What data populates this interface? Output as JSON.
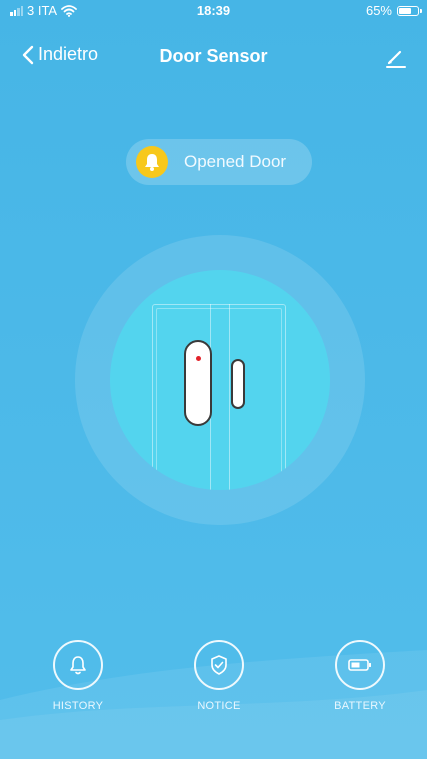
{
  "status_bar": {
    "carrier": "3 ITA",
    "time": "18:39",
    "battery_percent_label": "65%",
    "battery_level": 0.65,
    "signal_bars_filled": 2,
    "signal_bars_total": 4
  },
  "nav": {
    "back_label": "Indietro",
    "title": "Door Sensor",
    "edit_icon": "pencil-icon"
  },
  "device_status": {
    "label": "Opened Door",
    "icon": "bell-icon",
    "icon_color": "#f7c81b"
  },
  "illustration": {
    "led_color": "#e2222a",
    "disc_color": "#53d4ee"
  },
  "bottom_nav": {
    "items": [
      {
        "label": "HISTORY",
        "icon": "bell-outline-icon"
      },
      {
        "label": "NOTICE",
        "icon": "shield-check-icon"
      },
      {
        "label": "BATTERY",
        "icon": "battery-icon"
      }
    ]
  },
  "colors": {
    "background": "#4bb8e7",
    "accent": "#f7c81b"
  }
}
